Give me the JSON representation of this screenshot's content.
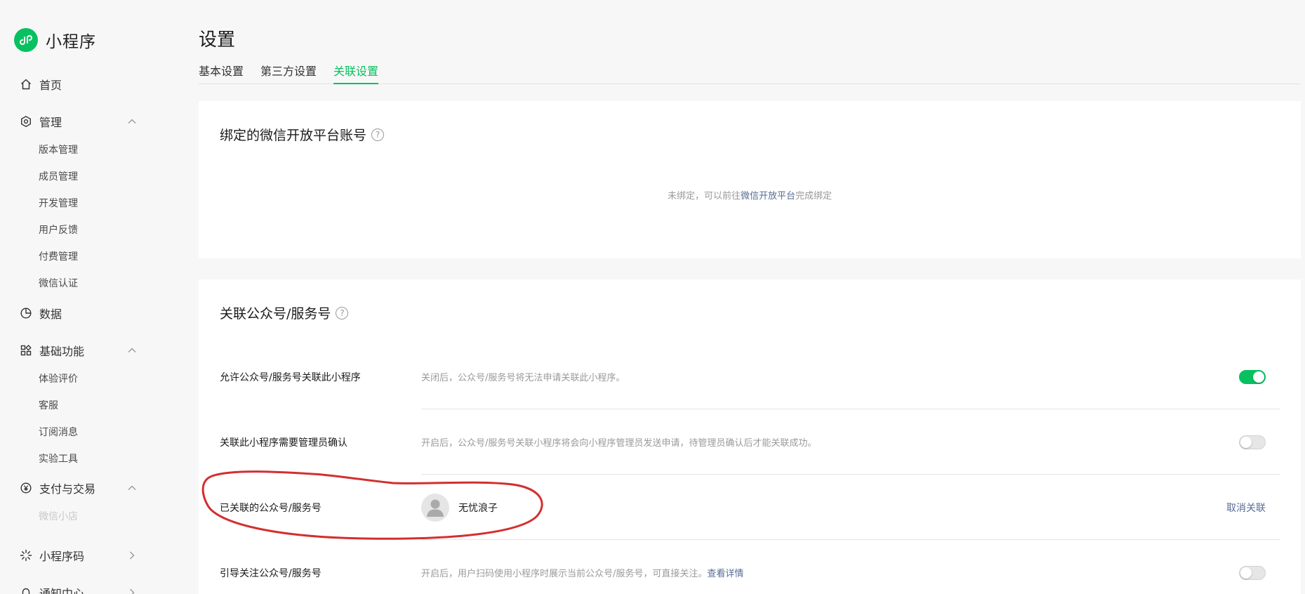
{
  "brand": {
    "name": "小程序"
  },
  "sidebar": {
    "home": "首页",
    "manage": {
      "label": "管理",
      "items": [
        "版本管理",
        "成员管理",
        "开发管理",
        "用户反馈",
        "付费管理",
        "微信认证"
      ]
    },
    "data": "数据",
    "basic": {
      "label": "基础功能",
      "items": [
        "体验评价",
        "客服",
        "订阅消息",
        "实验工具"
      ]
    },
    "pay": {
      "label": "支付与交易",
      "items": [
        "微信小店"
      ]
    },
    "qrcode": "小程序码",
    "notice": "通知中心"
  },
  "page": {
    "title": "设置",
    "tabs": [
      "基本设置",
      "第三方设置",
      "关联设置"
    ],
    "active_tab": "关联设置"
  },
  "open_platform": {
    "title": "绑定的微信开放平台账号",
    "help": "?",
    "msg_prefix": "未绑定，可以前往",
    "msg_link": "微信开放平台",
    "msg_suffix": "完成绑定"
  },
  "linked_accounts": {
    "title": "关联公众号/服务号",
    "help": "?",
    "rows": [
      {
        "label": "允许公众号/服务号关联此小程序",
        "desc": "关闭后，公众号/服务号将无法申请关联此小程序。",
        "switch_on": true
      },
      {
        "label": "关联此小程序需要管理员确认",
        "desc": "开启后，公众号/服务号关联小程序将会向小程序管理员发送申请，待管理员确认后才能关联成功。",
        "switch_on": false
      },
      {
        "label": "已关联的公众号/服务号",
        "account_name": "无忧浪子",
        "action": "取消关联"
      },
      {
        "label": "引导关注公众号/服务号",
        "desc": "开启后，用户扫码使用小程序时展示当前公众号/服务号，可直接关注。",
        "desc_link": "查看详情",
        "switch_on": false
      }
    ]
  },
  "colors": {
    "accent": "#07c160",
    "link": "#576b95",
    "annotation": "#d32f2f"
  }
}
